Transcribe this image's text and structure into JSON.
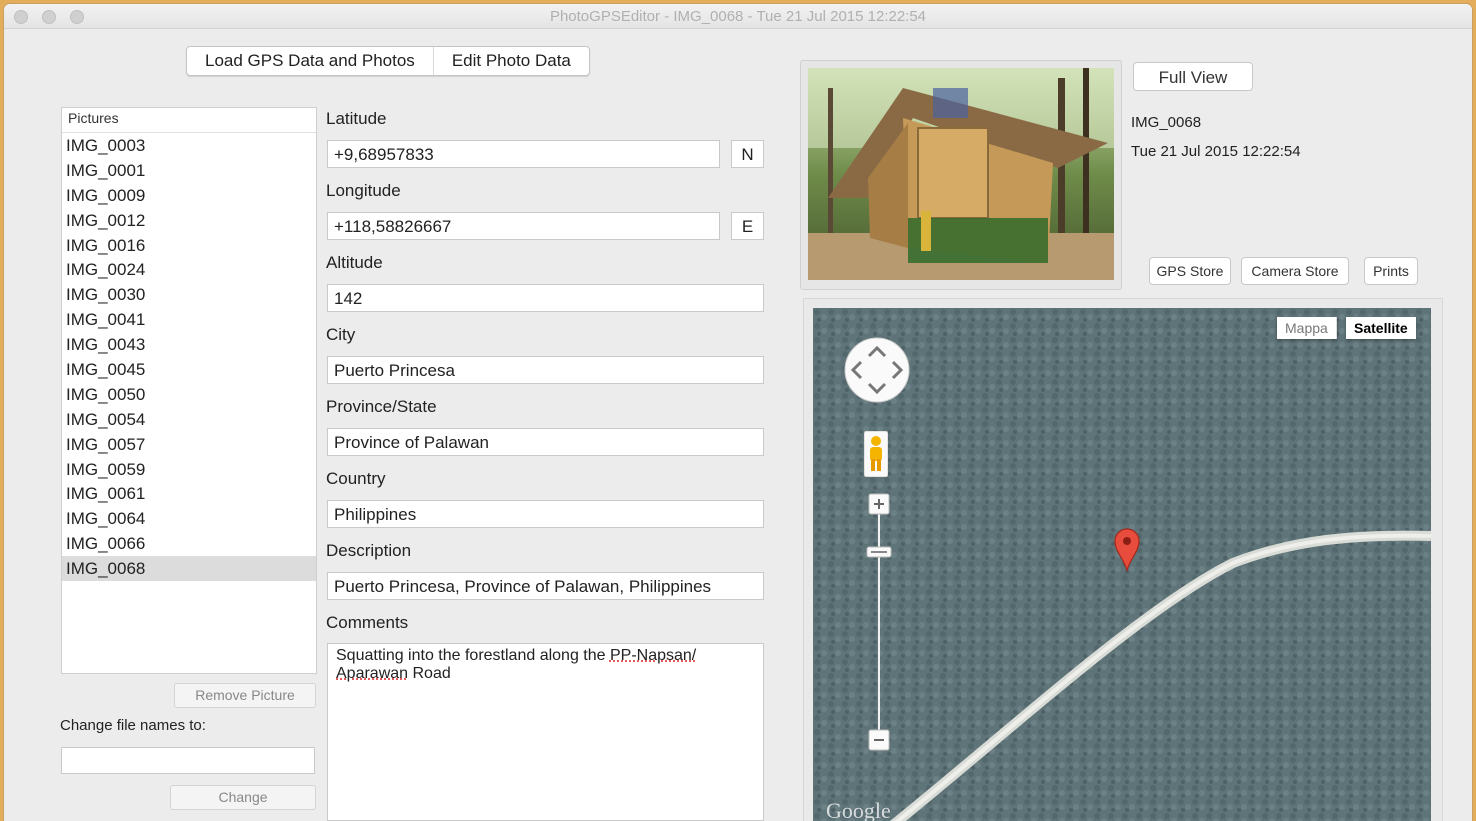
{
  "window": {
    "title": "PhotoGPSEditor - IMG_0068 - Tue 21 Jul 2015 12:22:54"
  },
  "tabs": [
    {
      "label": "Load GPS Data and Photos"
    },
    {
      "label": "Edit Photo Data"
    }
  ],
  "pictures": {
    "header": "Pictures",
    "items": [
      "IMG_0003",
      "IMG_0001",
      "IMG_0009",
      "IMG_0012",
      "IMG_0016",
      "IMG_0024",
      "IMG_0030",
      "IMG_0041",
      "IMG_0043",
      "IMG_0045",
      "IMG_0050",
      "IMG_0054",
      "IMG_0057",
      "IMG_0059",
      "IMG_0061",
      "IMG_0064",
      "IMG_0066",
      "IMG_0068"
    ],
    "selected": "IMG_0068",
    "remove_label": "Remove Picture",
    "change_names_label": "Change file names to:",
    "change_names_value": "",
    "change_label": "Change"
  },
  "form": {
    "latitude_label": "Latitude",
    "latitude_value": "+9,68957833",
    "latitude_dir": "N",
    "longitude_label": "Longitude",
    "longitude_value": "+118,58826667",
    "longitude_dir": "E",
    "altitude_label": "Altitude",
    "altitude_value": "142",
    "city_label": "City",
    "city_value": "Puerto Princesa",
    "province_label": "Province/State",
    "province_value": "Province of Palawan",
    "country_label": "Country",
    "country_value": "Philippines",
    "description_label": "Description",
    "description_value": "Puerto Princesa, Province of Palawan, Philippines",
    "comments_label": "Comments",
    "comments_text_1": "Squatting into the forestland along the ",
    "comments_text_2": "PP-Napsan/",
    "comments_text_3": "Aparawan",
    "comments_text_4": " Road"
  },
  "preview": {
    "full_view_label": "Full View",
    "filename": "IMG_0068",
    "datetime": "Tue 21 Jul 2015 12:22:54",
    "gps_store_label": "GPS Store",
    "camera_store_label": "Camera Store",
    "prints_label": "Prints"
  },
  "map": {
    "type_map_label": "Mappa",
    "type_satellite_label": "Satellite",
    "active_type": "Satellite",
    "attribution": "Google"
  }
}
